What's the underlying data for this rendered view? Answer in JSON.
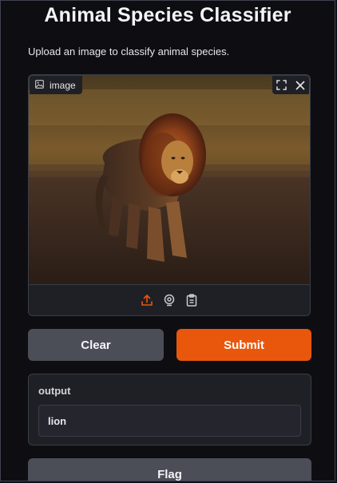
{
  "app": {
    "title": "Animal Species Classifier",
    "description": "Upload an image to classify animal species."
  },
  "image_input": {
    "label": "image",
    "controls": {
      "fullscreen_icon": "fullscreen-icon",
      "close_icon": "close-icon"
    },
    "sources": [
      {
        "name": "upload-icon",
        "active": true
      },
      {
        "name": "webcam-icon",
        "active": false
      },
      {
        "name": "clipboard-icon",
        "active": false
      }
    ]
  },
  "buttons": {
    "clear": "Clear",
    "submit": "Submit",
    "flag": "Flag"
  },
  "output": {
    "label": "output",
    "value": "lion"
  },
  "colors": {
    "accent": "#e8570c",
    "background": "#0e0e12",
    "panel": "#1f2026",
    "secondary_button": "#4b4d57"
  }
}
